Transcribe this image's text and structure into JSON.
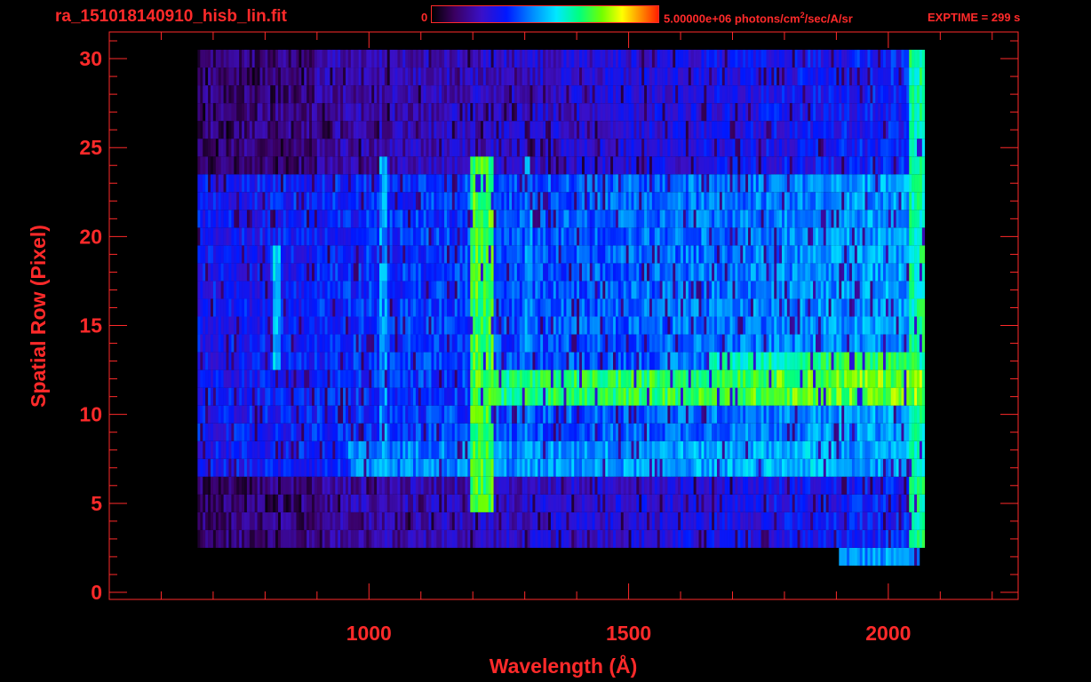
{
  "header": {
    "title": "ra_151018140910_hisb_lin.fit",
    "colorbar_min": "0",
    "colorbar_max_prefix": "5.00000e+06 photons/cm",
    "colorbar_max_exp": "2",
    "colorbar_max_suffix": "/sec/A/sr",
    "exptime": "EXPTIME = 299 s"
  },
  "colors": {
    "axis": "#ff2a2a",
    "background": "#000000"
  },
  "chart_data": {
    "type": "heatmap",
    "title": "ra_151018140910_hisb_lin.fit",
    "xlabel": "Wavelength (Å)",
    "ylabel": "Spatial Row (Pixel)",
    "xlim": [
      500,
      2250
    ],
    "ylim": [
      -0.4,
      31.5
    ],
    "x_ticks": [
      1000,
      1500,
      2000
    ],
    "y_ticks": [
      0,
      5,
      10,
      15,
      20,
      25,
      30
    ],
    "colorbar": {
      "min": 0,
      "max": 5000000,
      "units": "photons/cm^2/sec/A/sr",
      "colormap": "rainbow"
    },
    "coverage": {
      "x_range": [
        670,
        2065
      ],
      "row_range": [
        3,
        30
      ]
    },
    "features": [
      {
        "name": "Lyman-alpha line",
        "x": 1216,
        "rows": [
          5,
          24
        ],
        "level": 0.7
      },
      {
        "name": "bright streak",
        "x_range": [
          1200,
          2065
        ],
        "rows": [
          11,
          12
        ],
        "level": 0.75
      },
      {
        "name": "bright streak",
        "x_range": [
          1650,
          2050
        ],
        "rows": [
          12,
          13
        ],
        "level": 0.7
      },
      {
        "name": "streak",
        "x_range": [
          960,
          1900
        ],
        "rows": [
          7,
          8
        ],
        "level": 0.5
      },
      {
        "name": "line",
        "x": 1025,
        "rows": [
          7,
          24
        ],
        "level": 0.45
      },
      {
        "name": "line",
        "x": 1304,
        "rows": [
          7,
          24
        ],
        "level": 0.45
      },
      {
        "name": "line",
        "x": 820,
        "rows": [
          13,
          19
        ],
        "level": 0.5
      }
    ]
  }
}
